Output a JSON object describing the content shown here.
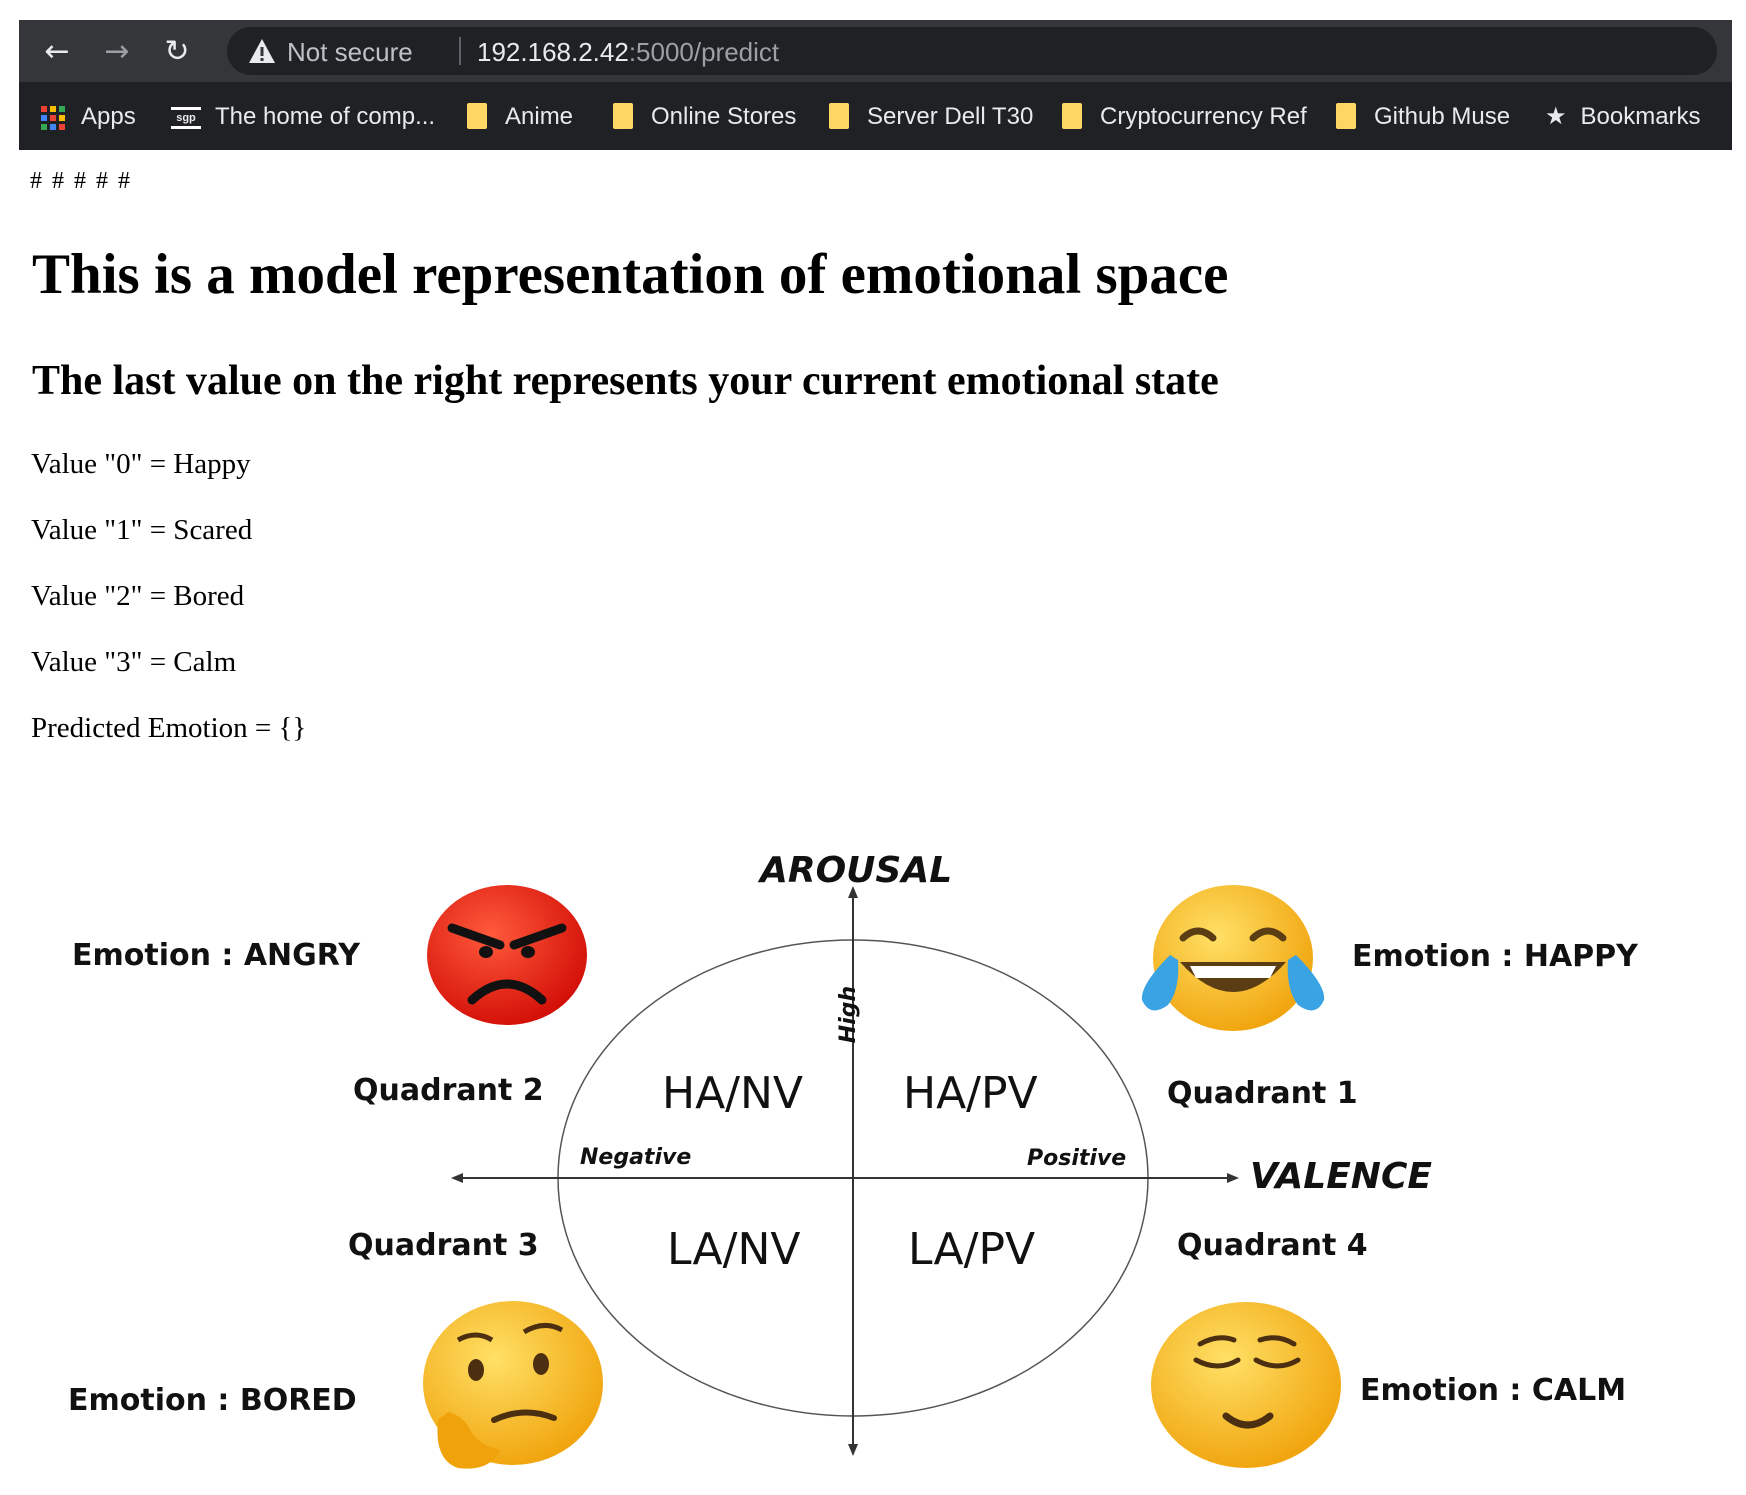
{
  "browser": {
    "security_label": "Not secure",
    "url_host": "192.168.2.42",
    "url_path": ":5000/predict",
    "nav": {
      "back_icon": "arrow-left-icon",
      "forward_icon": "arrow-right-icon",
      "reload_icon": "reload-icon"
    },
    "bookmarks": [
      {
        "label": "Apps",
        "icon": "apps-grid-icon"
      },
      {
        "label": "The home of comp...",
        "icon": "sgp-logo-icon"
      },
      {
        "label": "Anime",
        "icon": "folder-icon"
      },
      {
        "label": "Online Stores",
        "icon": "folder-icon"
      },
      {
        "label": "Server Dell T30",
        "icon": "folder-icon"
      },
      {
        "label": "Cryptocurrency Ref",
        "icon": "folder-icon"
      },
      {
        "label": "Github Muse",
        "icon": "folder-icon"
      },
      {
        "label": "Bookmarks",
        "icon": "star-icon"
      }
    ]
  },
  "page": {
    "hashes": "# # # # #",
    "title": "This is a model representation of emotional space",
    "subtitle": "The last value on the right represents your current emotional state",
    "values": [
      "Value \"0\" = Happy",
      "Value \"1\" = Scared",
      "Value \"2\" = Bored",
      "Value \"3\" = Calm"
    ],
    "predicted": "Predicted Emotion = {}"
  },
  "diagram": {
    "y_axis_title": "AROUSAL",
    "x_axis_title": "VALENCE",
    "high_label": "High",
    "negative_label": "Negative",
    "positive_label": "Positive",
    "quadrants": {
      "q1": {
        "label": "Quadrant 1",
        "code": "HA/PV",
        "emotion": "Emotion : HAPPY"
      },
      "q2": {
        "label": "Quadrant 2",
        "code": "HA/NV",
        "emotion": "Emotion : ANGRY"
      },
      "q3": {
        "label": "Quadrant 3",
        "code": "LA/NV",
        "emotion": "Emotion : BORED"
      },
      "q4": {
        "label": "Quadrant 4",
        "code": "LA/PV",
        "emotion": "Emotion : CALM"
      }
    },
    "colors": {
      "angry": "#e8160c",
      "happy": "#f9b90c",
      "bored": "#f7b51d",
      "calm": "#f2ad17",
      "tears": "#3aa3e3"
    }
  }
}
